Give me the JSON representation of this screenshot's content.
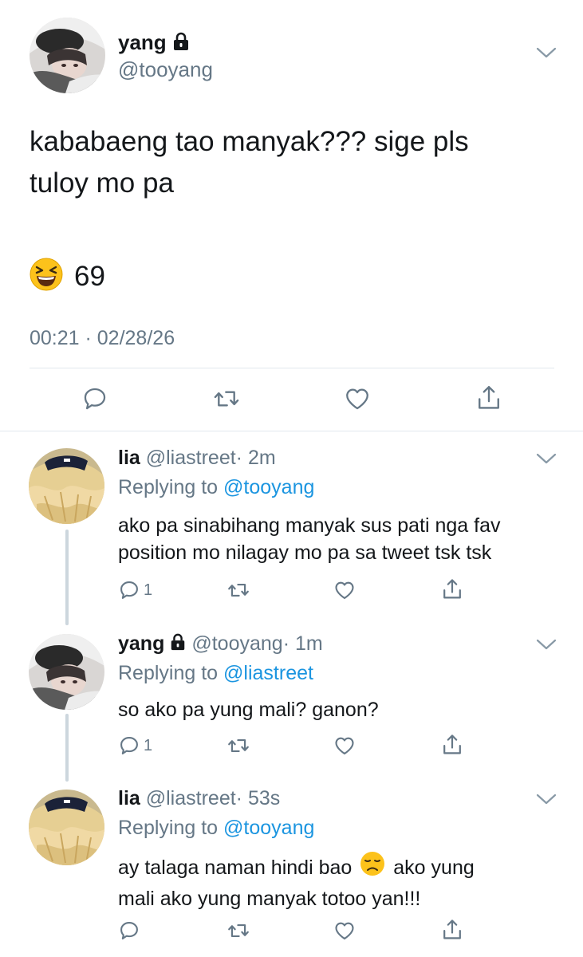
{
  "main_tweet": {
    "display_name": "yang",
    "handle": "@tooyang",
    "text_line1": "kababaeng tao manyak??? sige pls",
    "text_line2": "tuloy mo pa",
    "reaction_count": "69",
    "timestamp": "00:21 · 02/28/26"
  },
  "replies": [
    {
      "display_name": "lia",
      "handle": "@liastreet",
      "time": "· 2m",
      "replying_prefix": "Replying to",
      "replying_to": "@tooyang",
      "text_line1": "ako pa sinabihang manyak sus pati nga fav",
      "text_line2": "position mo nilagay mo pa sa tweet tsk tsk",
      "reply_count": "1"
    },
    {
      "display_name": "yang",
      "handle": "@tooyang",
      "time": "· 1m",
      "replying_prefix": "Replying to",
      "replying_to": "@liastreet",
      "text_line1": "so ako pa yung mali? ganon?",
      "reply_count": "1"
    },
    {
      "display_name": "lia",
      "handle": "@liastreet",
      "time": "· 53s",
      "replying_prefix": "Replying to",
      "replying_to": "@tooyang",
      "text_line1_a": "ay talaga naman hindi bao",
      "text_line1_b": "ako yung",
      "text_line2": "mali ako yung manyak totoo yan!!!",
      "reply_count": ""
    }
  ],
  "colors": {
    "text": "#14171a",
    "muted": "#657786",
    "link": "#1b95e0",
    "divider": "#e1e8ed"
  },
  "icons": [
    "lock-icon",
    "chevron-down-icon",
    "reply-icon",
    "retweet-icon",
    "like-icon",
    "share-icon",
    "grinning-squinting-emoji",
    "disappointed-emoji"
  ]
}
